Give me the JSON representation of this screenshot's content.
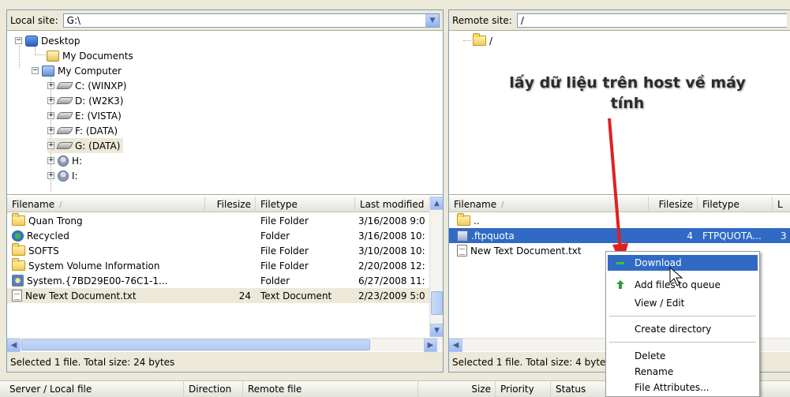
{
  "local": {
    "site_label": "Local site:",
    "site_path": "G:\\",
    "tree": [
      {
        "label": "Desktop",
        "icon": "desktop-icon"
      },
      {
        "label": "My Documents",
        "icon": "my-documents-icon"
      },
      {
        "label": "My Computer",
        "icon": "my-computer-icon"
      },
      {
        "label": "C: (WINXP)",
        "icon": "drive-icon"
      },
      {
        "label": "D: (W2K3)",
        "icon": "drive-icon"
      },
      {
        "label": "E: (VISTA)",
        "icon": "drive-icon"
      },
      {
        "label": "F: (DATA)",
        "icon": "drive-icon"
      },
      {
        "label": "G: (DATA)",
        "icon": "drive-icon"
      },
      {
        "label": "H:",
        "icon": "network-drive-icon"
      },
      {
        "label": "I:",
        "icon": "network-drive-icon"
      }
    ],
    "columns": {
      "filename": "Filename",
      "sort": "/",
      "filesize": "Filesize",
      "filetype": "Filetype",
      "modified": "Last modified"
    },
    "files": [
      {
        "name": "Quan Trong",
        "size": "",
        "type": "File Folder",
        "modified": "3/16/2008 9:0",
        "icon": "folder-icon"
      },
      {
        "name": "Recycled",
        "size": "",
        "type": "Folder",
        "modified": "3/16/2008 10:",
        "icon": "recycle-bin-icon"
      },
      {
        "name": "SOFTS",
        "size": "",
        "type": "File Folder",
        "modified": "3/10/2008 10:",
        "icon": "folder-icon"
      },
      {
        "name": "System Volume Information",
        "size": "",
        "type": "File Folder",
        "modified": "2/20/2008 12:",
        "icon": "folder-icon"
      },
      {
        "name": "System.{7BD29E00-76C1-1...",
        "size": "",
        "type": "Folder",
        "modified": "6/27/2008 11:",
        "icon": "system-folder-icon"
      },
      {
        "name": "New Text Document.txt",
        "size": "24",
        "type": "Text Document",
        "modified": "2/23/2009 5:0",
        "icon": "text-file-icon"
      }
    ],
    "status": "Selected 1 file. Total size: 24 bytes"
  },
  "remote": {
    "site_label": "Remote site:",
    "site_path": "/",
    "tree_root": "/",
    "columns": {
      "filename": "Filename",
      "sort": "/",
      "filesize": "Filesize",
      "filetype": "Filetype",
      "modified": "L"
    },
    "files": [
      {
        "name": "..",
        "size": "",
        "type": "",
        "modified": "",
        "icon": "parent-folder-icon"
      },
      {
        "name": ".ftpquota",
        "size": "4",
        "type": "FTPQUOTA...",
        "modified": "3",
        "icon": "config-file-icon"
      },
      {
        "name": "New Text Document.txt",
        "size": "",
        "type": "",
        "modified": "",
        "icon": "text-file-icon"
      }
    ],
    "status": "Selected 1 file. Total size: 4 bytes"
  },
  "queue": {
    "server_local": "Server / Local file",
    "direction": "Direction",
    "remote_file": "Remote file",
    "size": "Size",
    "priority": "Priority",
    "status": "Status"
  },
  "annotation": "lấy dữ liệu trên host về máy tính",
  "context_menu": {
    "download": "Download",
    "add_to_queue": "Add files to queue",
    "view_edit": "View / Edit",
    "create_directory": "Create directory",
    "delete": "Delete",
    "rename": "Rename",
    "file_attributes": "File Attributes..."
  },
  "colors": {
    "selection": "#316ac5",
    "window_bg": "#ece9d8",
    "border": "#7f9db9",
    "arrow": "#e02020"
  }
}
